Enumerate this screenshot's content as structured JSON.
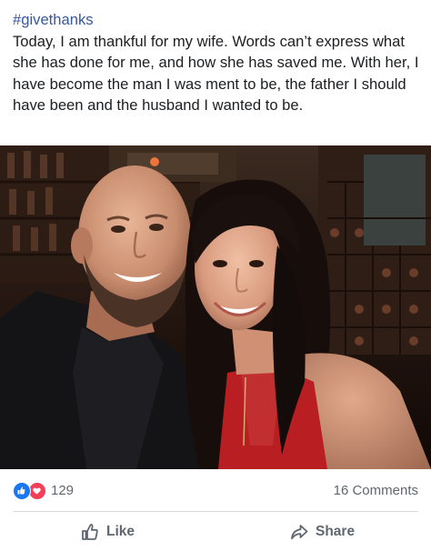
{
  "post": {
    "hashtag": "#givethanks",
    "text": "Today, I am thankful for my wife. Words can’t express what she has done for me, and how she has saved me. With her, I have become the man I was ment to be, the father I should have been and the husband I wanted to be.",
    "photo_alt": "Selfie of a bald bearded man and a dark-haired woman in a red top, smiling in front of a wine rack"
  },
  "stats": {
    "reaction_icons": [
      "like-icon",
      "love-icon"
    ],
    "reaction_count": "129",
    "comments_count": "16 Comments"
  },
  "actions": {
    "like_label": "Like",
    "share_label": "Share"
  },
  "colors": {
    "link": "#385898",
    "like_blue": "#1877f2",
    "love_red": "#f33e58",
    "secondary_text": "#606770",
    "divider": "#dadde1"
  }
}
